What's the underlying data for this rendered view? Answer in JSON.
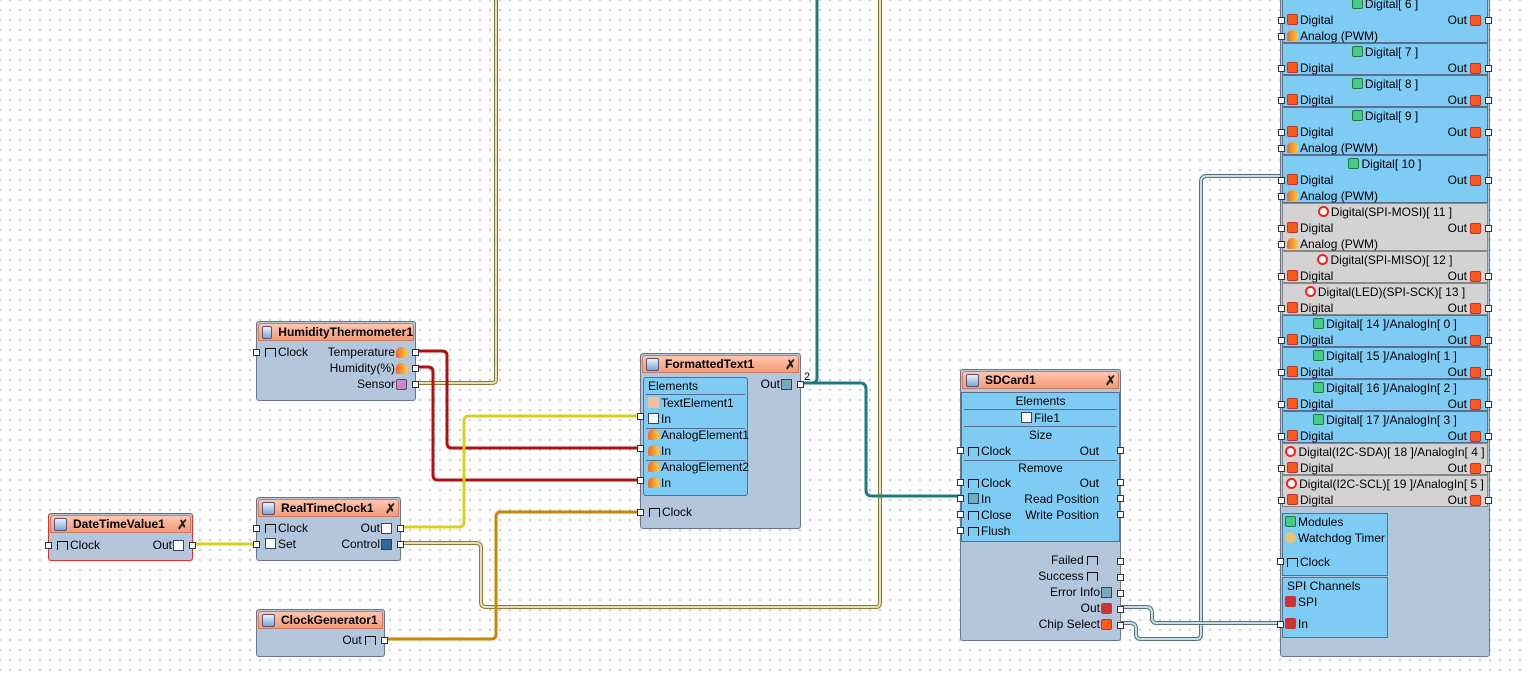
{
  "date_time_value": {
    "title": "DateTimeValue1",
    "clock": "Clock",
    "out": "Out"
  },
  "humidity_thermometer": {
    "title": "HumidityThermometer1",
    "clock": "Clock",
    "temperature": "Temperature",
    "humidity": "Humidity(%)",
    "sensor": "Sensor"
  },
  "real_time_clock": {
    "title": "RealTimeClock1",
    "clock": "Clock",
    "set": "Set",
    "out": "Out",
    "control": "Control"
  },
  "clock_generator": {
    "title": "ClockGenerator1",
    "out": "Out"
  },
  "formatted_text": {
    "title": "FormattedText1",
    "elements": "Elements",
    "out": "Out",
    "out_count": "2",
    "text_element": "TextElement1",
    "in1": "In",
    "analog_element1": "AnalogElement1",
    "in2": "In",
    "analog_element2": "AnalogElement2",
    "in3": "In",
    "clock": "Clock"
  },
  "sd_card": {
    "title": "SDCard1",
    "elements": "Elements",
    "file": "File1",
    "size": "Size",
    "size_clock": "Clock",
    "size_out": "Out",
    "remove": "Remove",
    "remove_clock": "Clock",
    "remove_out": "Out",
    "in": "In",
    "read_position": "Read Position",
    "close": "Close",
    "write_position": "Write Position",
    "flush": "Flush",
    "failed": "Failed",
    "success": "Success",
    "error_info": "Error Info",
    "out": "Out",
    "chip_select": "Chip Select"
  },
  "arduino": {
    "pins": [
      {
        "title": "Digital[ 6 ]",
        "digital": "Digital",
        "out": "Out",
        "analog": "Analog (PWM)",
        "state": "normal"
      },
      {
        "title": "Digital[ 7 ]",
        "digital": "Digital",
        "out": "Out",
        "state": "normal"
      },
      {
        "title": "Digital[ 8 ]",
        "digital": "Digital",
        "out": "Out",
        "state": "normal"
      },
      {
        "title": "Digital[ 9 ]",
        "digital": "Digital",
        "out": "Out",
        "analog": "Analog (PWM)",
        "state": "normal"
      },
      {
        "title": "Digital[ 10 ]",
        "digital": "Digital",
        "out": "Out",
        "analog": "Analog (PWM)",
        "state": "normal"
      },
      {
        "title": "Digital(SPI-MOSI)[ 11 ]",
        "digital": "Digital",
        "out": "Out",
        "analog": "Analog (PWM)",
        "state": "disabled"
      },
      {
        "title": "Digital(SPI-MISO)[ 12 ]",
        "digital": "Digital",
        "out": "Out",
        "state": "disabled"
      },
      {
        "title": "Digital(LED)(SPI-SCK)[ 13 ]",
        "digital": "Digital",
        "out": "Out",
        "state": "disabled"
      },
      {
        "title": "Digital[ 14 ]/AnalogIn[ 0 ]",
        "digital": "Digital",
        "out": "Out",
        "state": "normal"
      },
      {
        "title": "Digital[ 15 ]/AnalogIn[ 1 ]",
        "digital": "Digital",
        "out": "Out",
        "state": "normal"
      },
      {
        "title": "Digital[ 16 ]/AnalogIn[ 2 ]",
        "digital": "Digital",
        "out": "Out",
        "state": "normal"
      },
      {
        "title": "Digital[ 17 ]/AnalogIn[ 3 ]",
        "digital": "Digital",
        "out": "Out",
        "state": "normal"
      },
      {
        "title": "Digital(I2C-SDA)[ 18 ]/AnalogIn[ 4 ]",
        "digital": "Digital",
        "out": "Out",
        "state": "disabled"
      },
      {
        "title": "Digital(I2C-SCL)[ 19 ]/AnalogIn[ 5 ]",
        "digital": "Digital",
        "out": "Out",
        "state": "disabled"
      }
    ],
    "modules": "Modules",
    "watchdog": "Watchdog Timer",
    "watchdog_clock": "Clock",
    "spi_channels": "SPI Channels",
    "spi": "SPI",
    "spi_in": "In"
  },
  "colors": {
    "wire_yellow": "#d8d020",
    "wire_red": "#b01010",
    "wire_teal": "#1f7a80",
    "wire_orange": "#c98600",
    "wire_beige": "#d6cc8c",
    "wire_lightblue": "#8fb7c0",
    "header": "#f29a78",
    "body": "#b4c6dc",
    "element": "#7ecbf4"
  }
}
